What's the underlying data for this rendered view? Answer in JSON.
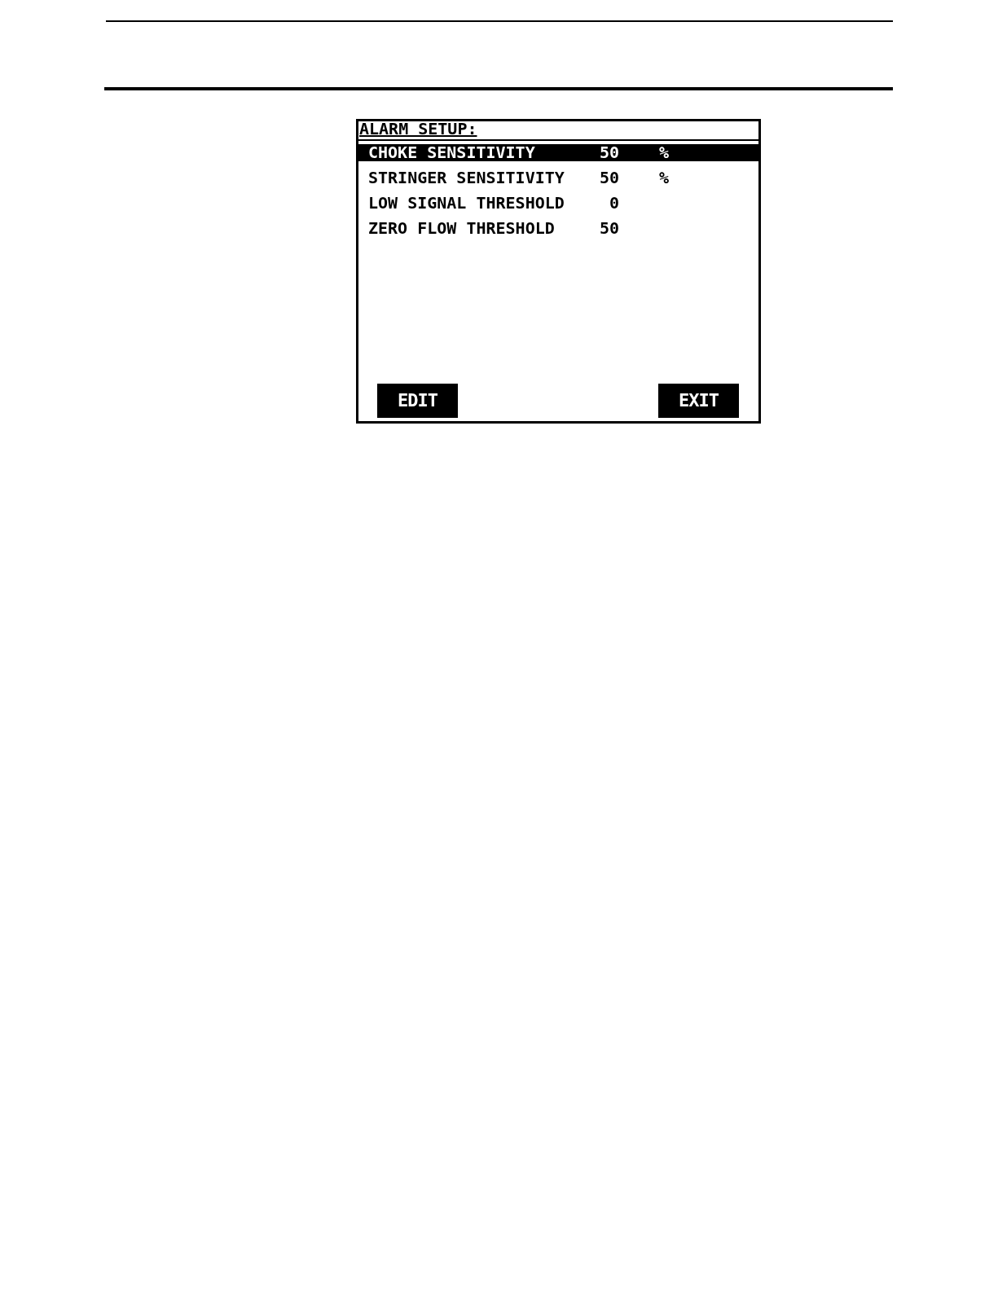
{
  "screen": {
    "title": "ALARM SETUP:",
    "rows": [
      {
        "label": "CHOKE SENSITIVITY",
        "value": "50",
        "unit": "%",
        "selected": true
      },
      {
        "label": "STRINGER SENSITIVITY",
        "value": "50",
        "unit": "%",
        "selected": false
      },
      {
        "label": "LOW SIGNAL THRESHOLD",
        "value": "0",
        "selected": false
      },
      {
        "label": "ZERO FLOW THRESHOLD",
        "value": "50",
        "selected": false
      }
    ],
    "buttons": [
      {
        "label": "EDIT"
      },
      {
        "label": "EXIT"
      }
    ]
  }
}
